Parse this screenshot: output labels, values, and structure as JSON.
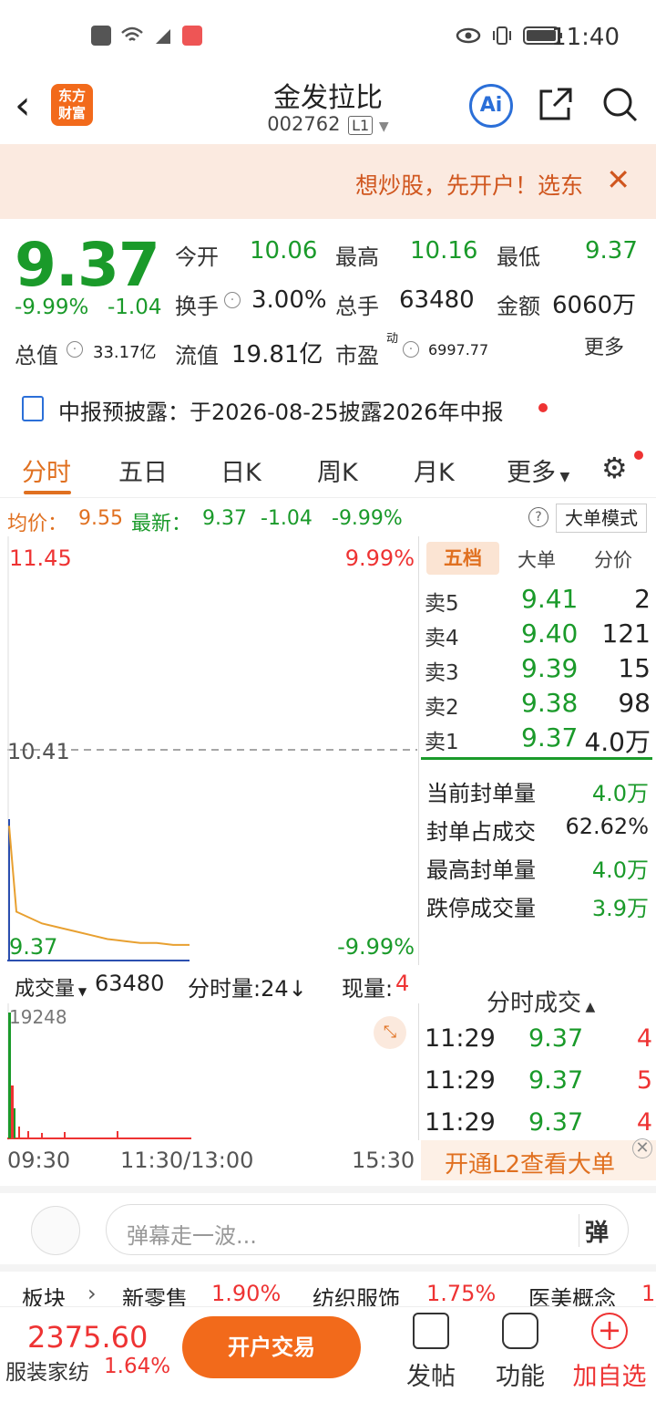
{
  "status_bar": {
    "time": "11:40"
  },
  "header": {
    "logo": "东方\n财富",
    "title": "金发拉比",
    "code": "002762",
    "code_tag": "L1",
    "ai_label": "Ai"
  },
  "banner": {
    "text": "想炒股，先开户！选东"
  },
  "quote": {
    "price": "9.37",
    "change_pct": "-9.99%",
    "change": "-1.04",
    "open_label": "今开",
    "open": "10.06",
    "high_label": "最高",
    "high": "10.16",
    "low_label": "最低",
    "low": "9.37",
    "turnover_label": "换手",
    "turnover": "3.00%",
    "volume_label": "总手",
    "volume": "63480",
    "amount_label": "金额",
    "amount": "6060万",
    "mktcap_label": "总值",
    "mktcap": "33.17亿",
    "float_label": "流值",
    "float": "19.81亿",
    "pe_label": "市盈",
    "pe_sup": "动",
    "pe": "6997.77",
    "more": "更多"
  },
  "notice": {
    "text": "中报预披露：于2026-08-25披露2026年中报"
  },
  "tabs": [
    "分时",
    "五日",
    "日K",
    "周K",
    "月K",
    "更多"
  ],
  "avg_bar": {
    "avg_label": "均价：",
    "avg": "9.55",
    "latest_label": "最新：",
    "latest": "9.37",
    "chg": "-1.04",
    "pct": "-9.99%",
    "mode": "大单模式"
  },
  "chart_data": {
    "type": "line",
    "y_top": "11.45",
    "y_mid": "10.41",
    "y_bottom": "9.37",
    "pct_top": "9.99%",
    "pct_bottom": "-9.99%",
    "x_labels": [
      "09:30",
      "11:30/13:00",
      "15:30"
    ],
    "ylim": [
      9.37,
      11.45
    ],
    "series": [
      {
        "values": [
          10.06,
          9.62,
          9.56,
          9.54,
          9.52,
          9.5,
          9.48,
          9.47,
          9.46,
          9.46,
          9.45,
          9.45
        ]
      }
    ]
  },
  "order_book": {
    "tabs": [
      "五档",
      "大单",
      "分价"
    ],
    "rows": [
      {
        "label": "卖5",
        "price": "9.41",
        "qty": "2"
      },
      {
        "label": "卖4",
        "price": "9.40",
        "qty": "121"
      },
      {
        "label": "卖3",
        "price": "9.39",
        "qty": "15"
      },
      {
        "label": "卖2",
        "price": "9.38",
        "qty": "98"
      },
      {
        "label": "卖1",
        "price": "9.37",
        "qty": "4.0万"
      }
    ],
    "seal": [
      {
        "label": "当前封单量",
        "value": "4.0万"
      },
      {
        "label": "封单占成交",
        "value": "62.62%"
      },
      {
        "label": "最高封单量",
        "value": "4.0万"
      },
      {
        "label": "跌停成交量",
        "value": "3.9万"
      }
    ]
  },
  "volume": {
    "label": "成交量",
    "total": "63480",
    "minute_label": "分时量:24↓",
    "now_label": "现量:",
    "now": "4",
    "max": "19248"
  },
  "ticks": {
    "title": "分时成交",
    "rows": [
      {
        "time": "11:29",
        "price": "9.37",
        "qty": "4"
      },
      {
        "time": "11:29",
        "price": "9.37",
        "qty": "5"
      },
      {
        "time": "11:29",
        "price": "9.37",
        "qty": "4"
      }
    ],
    "l2": "开通L2查看大单"
  },
  "barrage": {
    "placeholder": "弹幕走一波...",
    "send": "弹"
  },
  "sector": {
    "label": "板块",
    "items": [
      {
        "name": "新零售",
        "pct": "1.90%"
      },
      {
        "name": "纺织服饰",
        "pct": "1.75%"
      },
      {
        "name": "医美概念",
        "pct": "1"
      }
    ]
  },
  "bottom": {
    "index": "2375.60",
    "index_name": "服装家纺",
    "index_pct": "1.64%",
    "trade": "开户交易",
    "post": "发帖",
    "func": "功能",
    "add": "加自选"
  }
}
